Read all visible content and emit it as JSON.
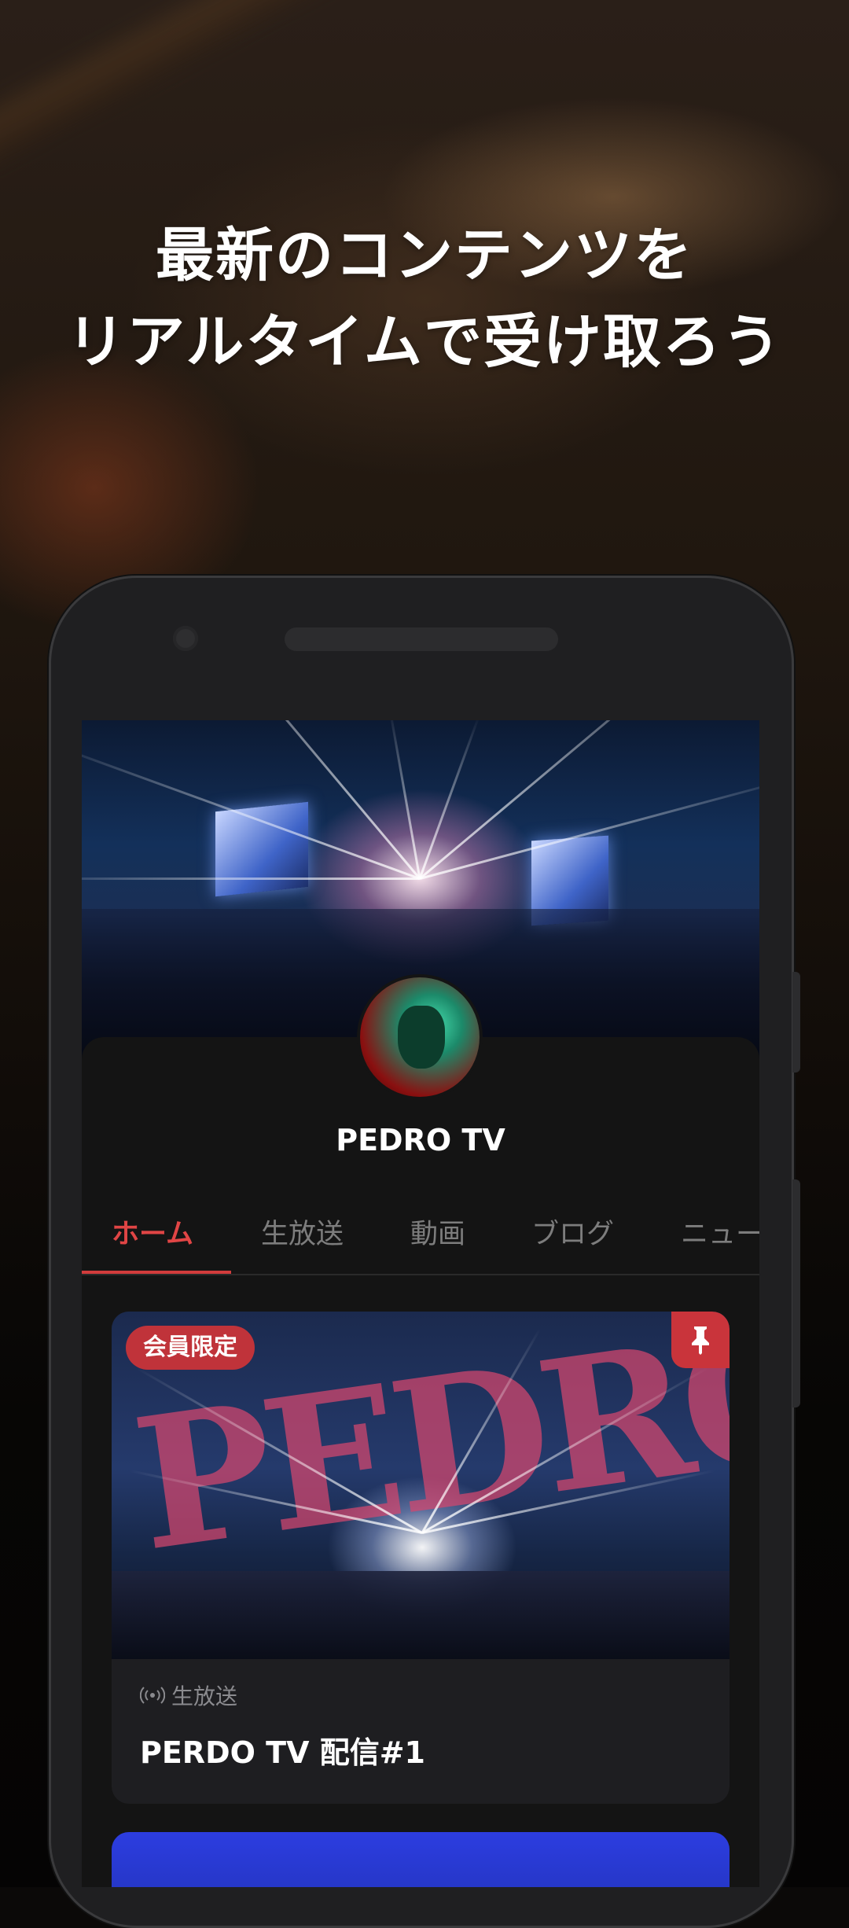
{
  "headline": {
    "line1": "最新のコンテンツを",
    "line2": "リアルタイムで受け取ろう"
  },
  "channel": {
    "name": "PEDRO TV"
  },
  "tabs": [
    {
      "label": "ホーム",
      "active": true
    },
    {
      "label": "生放送",
      "active": false
    },
    {
      "label": "動画",
      "active": false
    },
    {
      "label": "ブログ",
      "active": false
    },
    {
      "label": "ニュー",
      "active": false
    }
  ],
  "cards": [
    {
      "badge": "会員限定",
      "category": "生放送",
      "category_icon": "broadcast-icon",
      "title": "PERDO TV 配信#1",
      "thumbnail_logo": "PEDRO",
      "pinned": true
    }
  ],
  "colors": {
    "accent": "#d23c3c",
    "badge": "#c0333a",
    "background": "#121212"
  }
}
